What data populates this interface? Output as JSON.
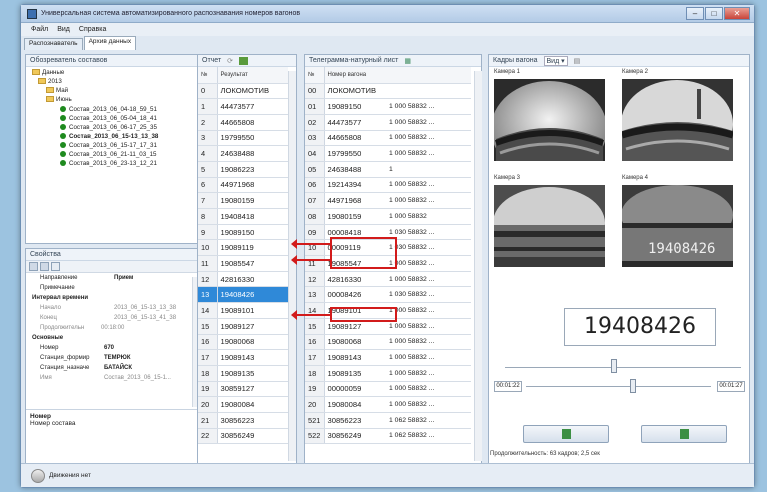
{
  "window": {
    "title": "Универсальная система автоматизированного распознавания номеров вагонов"
  },
  "menu": [
    "Файл",
    "Вид",
    "Справка"
  ],
  "tabs": [
    "Распознаватель",
    "Архив данных"
  ],
  "browser": {
    "title": "Обозреватель составов",
    "root": "Данные",
    "year": "2013",
    "months": [
      "Май",
      "Июнь"
    ],
    "items": [
      "Состав_2013_06_04-18_59_51",
      "Состав_2013_06_05-04_18_41",
      "Состав_2013_06_06-17_25_35",
      "Состав_2013_06_15-13_13_38",
      "Состав_2013_06_15-17_17_31",
      "Состав_2013_06_21-11_03_15",
      "Состав_2013_06_23-13_12_21"
    ]
  },
  "properties": {
    "title": "Свойства",
    "rows": [
      {
        "k": "Направление",
        "v": "Прием"
      },
      {
        "k": "Примечание",
        "v": ""
      },
      {
        "k": "Интервал времени",
        "v": ""
      },
      {
        "k": "Начало",
        "v": "2013_06_15-13_13_38"
      },
      {
        "k": "Конец",
        "v": "2013_06_15-13_41_38"
      },
      {
        "k": "Продолжительн",
        "v": "00:18:00"
      },
      {
        "k": "Основные",
        "v": ""
      },
      {
        "k": "Номер",
        "v": "670"
      },
      {
        "k": "Станция_формир",
        "v": "ТЕМРЮК"
      },
      {
        "k": "Станция_назначе",
        "v": "БАТАЙСК"
      },
      {
        "k": "Имя",
        "v": "Состав_2013_06_15-1..."
      }
    ],
    "desc_title": "Номер",
    "desc_text": "Номер состава"
  },
  "report": {
    "title": "Отчет",
    "headers": [
      "№",
      "Результат"
    ],
    "rows": [
      [
        "0",
        "ЛОКОМОТИВ"
      ],
      [
        "1",
        "44473577"
      ],
      [
        "2",
        "44665808"
      ],
      [
        "3",
        "19799550"
      ],
      [
        "4",
        "24638488"
      ],
      [
        "5",
        "19086223"
      ],
      [
        "6",
        "44971968"
      ],
      [
        "7",
        "19080159"
      ],
      [
        "8",
        "19408418"
      ],
      [
        "9",
        "19089150"
      ],
      [
        "10",
        "19089119"
      ],
      [
        "11",
        "19085547"
      ],
      [
        "12",
        "42816330"
      ],
      [
        "13",
        "19408426"
      ],
      [
        "14",
        "19089101"
      ],
      [
        "15",
        "19089127"
      ],
      [
        "16",
        "19080068"
      ],
      [
        "17",
        "19089143"
      ],
      [
        "18",
        "19089135"
      ],
      [
        "19",
        "30859127"
      ],
      [
        "20",
        "19080084"
      ],
      [
        "21",
        "30856223"
      ],
      [
        "22",
        "30856249"
      ]
    ]
  },
  "telegram": {
    "title": "Телеграмма-натурный лист",
    "headers": [
      "№",
      "Номер вагона",
      ""
    ],
    "rows": [
      [
        "00",
        "ЛОКОМОТИВ",
        ""
      ],
      [
        "01",
        "19089150",
        "1 000 58832 ..."
      ],
      [
        "02",
        "44473577",
        "1 000 58832 ..."
      ],
      [
        "03",
        "44665808",
        "1 000 58832 ..."
      ],
      [
        "04",
        "19799550",
        "1 000 58832 ..."
      ],
      [
        "05",
        "24638488",
        "1"
      ],
      [
        "06",
        "19214394",
        "1 000 58832 ..."
      ],
      [
        "07",
        "44971968",
        "1 000 58832 ..."
      ],
      [
        "08",
        "19080159",
        "1 000 58832"
      ],
      [
        "09",
        "00008418",
        "1 030 58832 ..."
      ],
      [
        "10",
        "00009119",
        "1 030 58832 ..."
      ],
      [
        "11",
        "19085547",
        "1 000 58832 ..."
      ],
      [
        "12",
        "42816330",
        "1 000 58832 ..."
      ],
      [
        "13",
        "00008426",
        "1 030 58832 ..."
      ],
      [
        "14",
        "19089101",
        "1 000 58832 ..."
      ],
      [
        "15",
        "19089127",
        "1 000 58832 ..."
      ],
      [
        "16",
        "19080068",
        "1 000 58832 ..."
      ],
      [
        "17",
        "19089143",
        "1 000 58832 ..."
      ],
      [
        "18",
        "19089135",
        "1 000 58832 ..."
      ],
      [
        "19",
        "00000059",
        "1 000 58832 ..."
      ],
      [
        "20",
        "19080084",
        "1 000 58832 ..."
      ],
      [
        "521",
        "30856223",
        "1 062 58832 ..."
      ],
      [
        "522",
        "30856249",
        "1 062 58832 ..."
      ]
    ]
  },
  "frames": {
    "title": "Кадры вагона",
    "view": "Вид",
    "cams": [
      "Камера 1",
      "Камера 2",
      "Камера 3",
      "Камера 4"
    ],
    "plate": "19408426",
    "number": "19408426",
    "time_start": "00:01:22",
    "time_end": "00:01:27",
    "duration": "Продолжительность: 63 кадров; 2,5 сек",
    "slider_top_level": 0.46,
    "slider_bottom_level": 0.58
  },
  "status": {
    "text": "Движения нет"
  },
  "colors": {
    "selection": "#2f89d8",
    "highlight": "#d21b1b"
  }
}
